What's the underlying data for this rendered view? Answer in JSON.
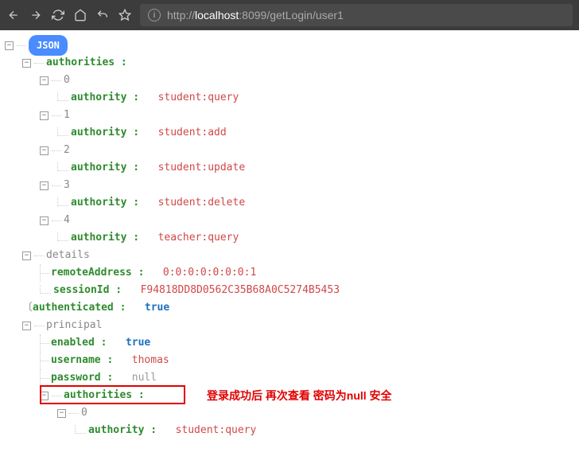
{
  "browser": {
    "url_host": "localhost",
    "url_port": ":8099",
    "url_path": "/getLogin/user1",
    "url_prefix": "http://"
  },
  "json_badge": "JSON",
  "tree": {
    "authorities_label": "authorities :",
    "authority_key": "authority :",
    "items": [
      {
        "idx": "0",
        "val": "student:query"
      },
      {
        "idx": "1",
        "val": "student:add"
      },
      {
        "idx": "2",
        "val": "student:update"
      },
      {
        "idx": "3",
        "val": "student:delete"
      },
      {
        "idx": "4",
        "val": "teacher:query"
      }
    ],
    "details_label": "details",
    "remoteAddress_key": "remoteAddress :",
    "remoteAddress_val": "0:0:0:0:0:0:0:1",
    "sessionId_key": "sessionId :",
    "sessionId_val": "F94818DD8D0562C35B68A0C5274B5453",
    "authenticated_key": "authenticated :",
    "authenticated_val": "true",
    "principal_label": "principal",
    "enabled_key": "enabled :",
    "enabled_val": "true",
    "username_key": "username :",
    "username_val": "thomas",
    "password_key": "password :",
    "password_val": "null",
    "p_auth_idx": "0",
    "p_auth_val": "student:query"
  },
  "annotation": "登录成功后 再次查看 密码为null 安全",
  "toggle_minus": "⊟"
}
